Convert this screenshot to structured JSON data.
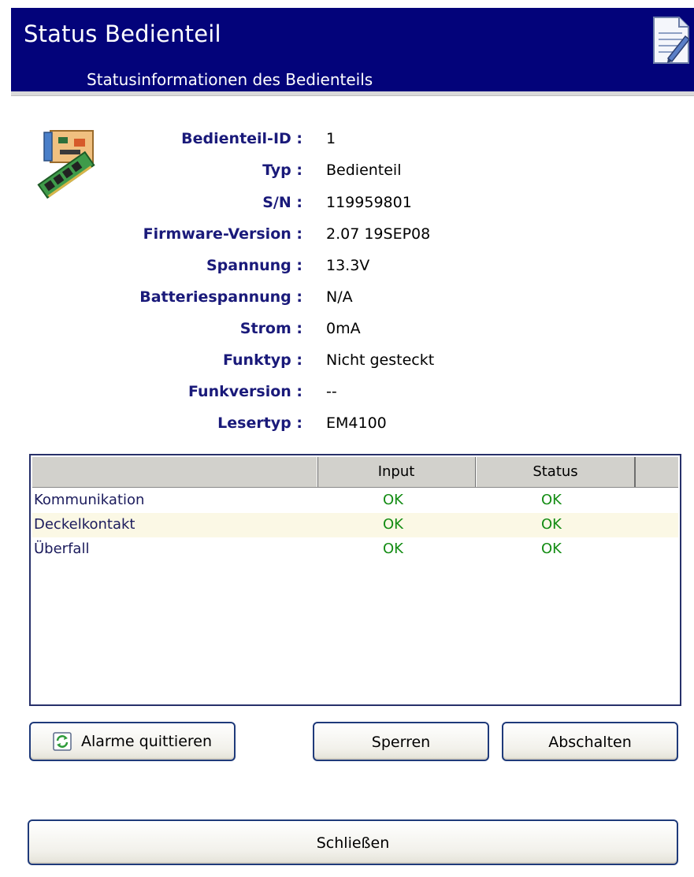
{
  "header": {
    "title": "Status Bedienteil",
    "subtitle": "Statusinformationen des Bedienteils"
  },
  "info": [
    {
      "label": "Bedienteil-ID :",
      "value": "1"
    },
    {
      "label": "Typ :",
      "value": "Bedienteil"
    },
    {
      "label": "S/N :",
      "value": "119959801"
    },
    {
      "label": "Firmware-Version :",
      "value": "2.07 19SEP08"
    },
    {
      "label": "Spannung :",
      "value": "13.3V"
    },
    {
      "label": "Batteriespannung :",
      "value": "N/A"
    },
    {
      "label": "Strom :",
      "value": "0mA"
    },
    {
      "label": "Funktyp :",
      "value": "Nicht gesteckt"
    },
    {
      "label": "Funkversion :",
      "value": "--"
    },
    {
      "label": "Lesertyp :",
      "value": "EM4100"
    }
  ],
  "table": {
    "columns": [
      "",
      "Input",
      "Status",
      ""
    ],
    "rows": [
      {
        "name": "Kommunikation",
        "input": "OK",
        "status": "OK"
      },
      {
        "name": "Deckelkontakt",
        "input": "OK",
        "status": "OK"
      },
      {
        "name": "Überfall",
        "input": "OK",
        "status": "OK"
      }
    ]
  },
  "buttons": {
    "alarm": "Alarme quittieren",
    "sperren": "Sperren",
    "abschalten": "Abschalten",
    "schliessen": "Schließen"
  },
  "colors": {
    "header_bg": "#03037a",
    "label_color": "#1a1a7a",
    "ok_color": "#138c13",
    "alt_row": "#fbf8e5"
  },
  "icons": {
    "header": "document-edit-icon",
    "device": "circuit-board-icon",
    "alarm_button": "refresh-icon"
  }
}
